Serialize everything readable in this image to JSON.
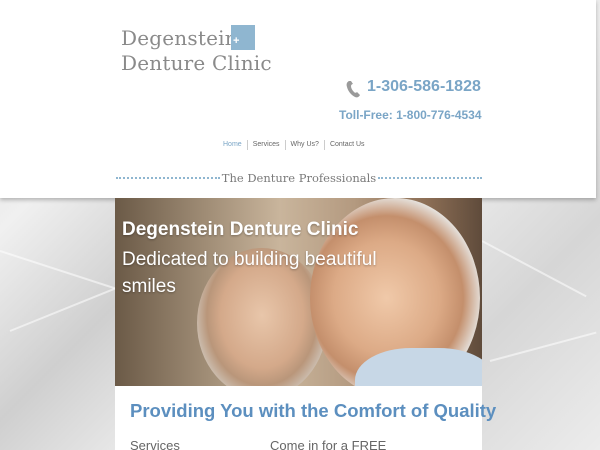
{
  "logo": {
    "line1": "Degenstein",
    "line2": "Denture Clinic",
    "mark": "+"
  },
  "contact": {
    "phone_icon": "phone-icon",
    "phone": "1-306-586-1828",
    "toll_free": "Toll-Free: 1-800-776-4534"
  },
  "nav": {
    "items": [
      {
        "label": "Home"
      },
      {
        "label": "Services"
      },
      {
        "label": "Why Us?"
      },
      {
        "label": "Contact Us"
      }
    ]
  },
  "tagline": "The Denture Professionals",
  "hero": {
    "title": "Degenstein Denture Clinic",
    "subtitle": "Dedicated to building beautiful smiles"
  },
  "content": {
    "heading": "Providing You with the Comfort of Quality",
    "services_label": "Services",
    "free_label": "Come in for a FREE"
  },
  "colors": {
    "accent": "#7aa5c6",
    "heading": "#5c8fbf",
    "logo_box": "#8fb6d0"
  }
}
